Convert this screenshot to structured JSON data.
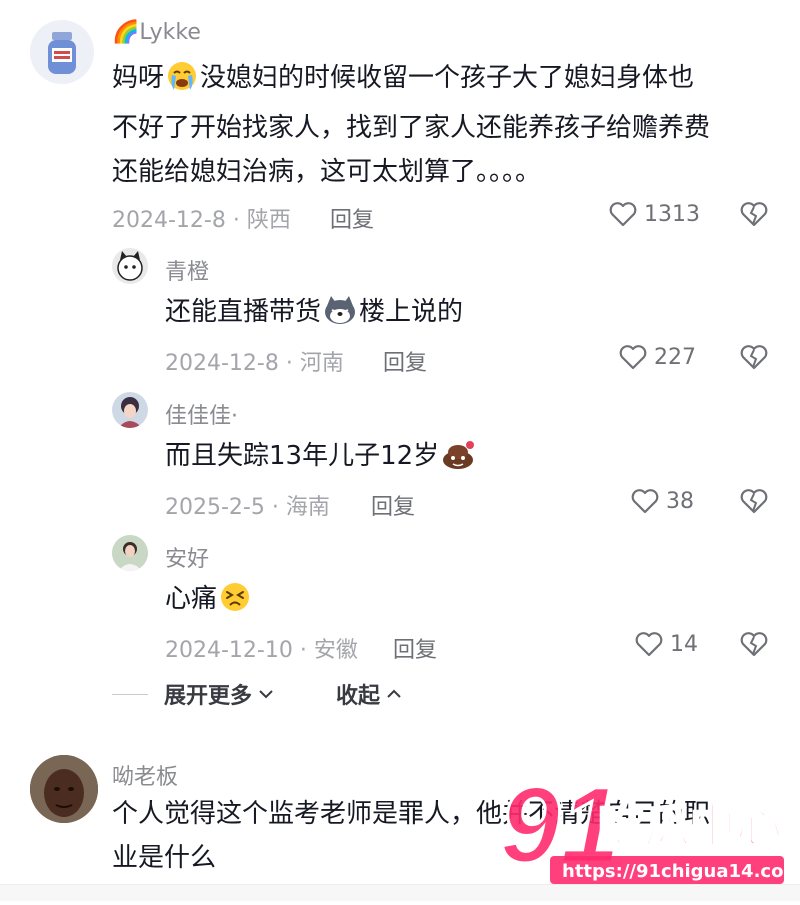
{
  "comments": [
    {
      "username": "Lykke",
      "rainbow_emoji": "🌈",
      "content_parts": [
        "妈呀",
        "没媳妇的时候收留一个孩子大了媳妇身体也",
        "不好了开始找家人，找到了家人还能养孩子给赡养费",
        "还能给媳妇治病，这可太划算了。。。。"
      ],
      "meta": "2024-12-8 · 陕西",
      "reply": "回复",
      "likes": "1313"
    }
  ],
  "replies": [
    {
      "username": "青橙",
      "content_before": "还能直播带货",
      "content_after": "楼上说的",
      "meta": "2024-12-8 · 河南",
      "reply": "回复",
      "likes": "227"
    },
    {
      "username": "佳佳佳·",
      "content_before": "而且失踪13年儿子12岁",
      "content_after": "",
      "meta": "2025-2-5 · 海南",
      "reply": "回复",
      "likes": "38"
    },
    {
      "username": "安好",
      "content_before": "心痛",
      "content_after": "",
      "meta": "2024-12-10 · 安徽",
      "reply": "回复",
      "likes": "14"
    }
  ],
  "expand": {
    "more": "展开更多",
    "collapse": "收起"
  },
  "next_comment": {
    "username": "呦老板",
    "line1": "个人觉得这个监考老师是罪人，他并不清楚自己的职",
    "line2": "业是什么"
  },
  "watermark": {
    "number": "91",
    "text": "吃瓜中心",
    "url": "https://91chigua14.com"
  }
}
